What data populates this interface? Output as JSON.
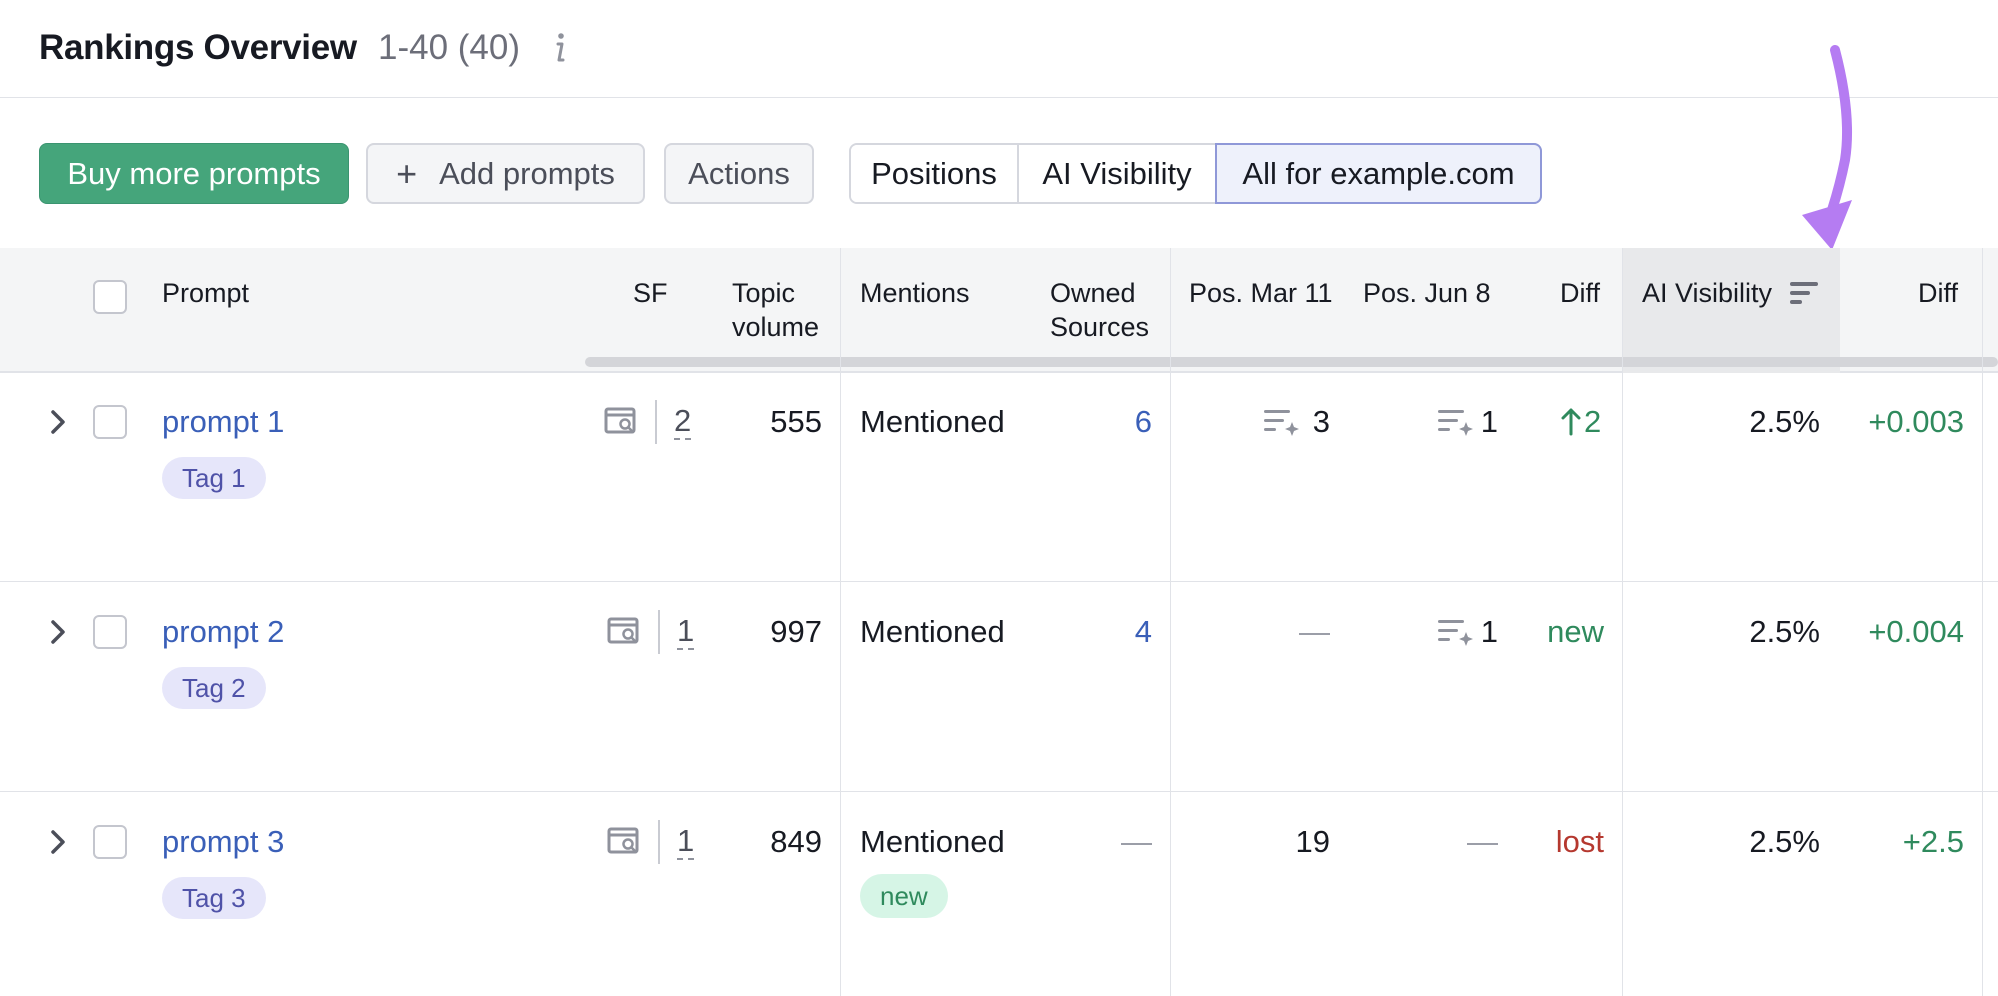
{
  "header": {
    "title": "Rankings Overview",
    "range": "1-40 (40)"
  },
  "toolbar": {
    "buy_label": "Buy more prompts",
    "add_label": "Add prompts",
    "actions_label": "Actions",
    "segments": [
      "Positions",
      "AI Visibility",
      "All for example.com"
    ],
    "selected_segment": "All for example.com"
  },
  "table": {
    "columns": {
      "prompt": "Prompt",
      "sf": "SF",
      "topic_volume_1": "Topic",
      "topic_volume_2": "volume",
      "mentions": "Mentions",
      "owned_1": "Owned",
      "owned_2": "Sources",
      "pos_mar": "Pos. Mar 11",
      "pos_jun": "Pos. Jun 8",
      "diff": "Diff",
      "ai_visibility": "AI Visibility",
      "diff2": "Diff"
    },
    "sorted_column": "AI Visibility",
    "rows": [
      {
        "prompt": "prompt 1",
        "tag": "Tag 1",
        "sf": "2",
        "volume": "555",
        "mentions": "Mentioned",
        "mentions_badge": "",
        "owned": "6",
        "pos_mar": "3",
        "pos_jun": "1",
        "diff": "2",
        "ai_visibility": "2.5%",
        "diff2": "+0.003"
      },
      {
        "prompt": "prompt 2",
        "tag": "Tag 2",
        "sf": "1",
        "volume": "997",
        "mentions": "Mentioned",
        "mentions_badge": "",
        "owned": "4",
        "pos_mar": "—",
        "pos_jun": "1",
        "diff": "new",
        "ai_visibility": "2.5%",
        "diff2": "+0.004"
      },
      {
        "prompt": "prompt 3",
        "tag": "Tag 3",
        "sf": "1",
        "volume": "849",
        "mentions": "Mentioned",
        "mentions_badge": "new",
        "owned": "—",
        "pos_mar": "19",
        "pos_jun": "—",
        "diff": "lost",
        "ai_visibility": "2.5%",
        "diff2": "+2.5"
      }
    ]
  },
  "colors": {
    "primary_green": "#45a57b",
    "link_blue": "#3a5fb8",
    "positive": "#2f8a5d",
    "negative": "#b5382f",
    "annotation_arrow": "#b57cf2"
  }
}
